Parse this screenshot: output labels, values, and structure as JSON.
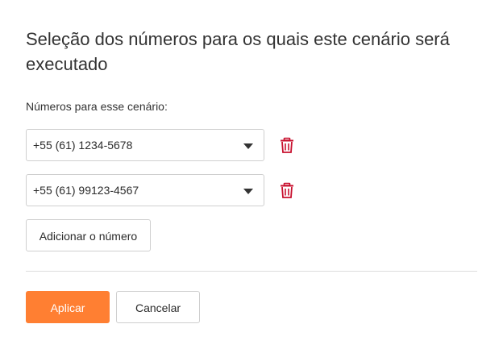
{
  "title": "Seleção dos números para os quais este cenário será executado",
  "numbers_label": "Números para esse cenário:",
  "numbers": [
    {
      "value": "+55 (61) 1234-5678",
      "delete_icon": "trash-icon"
    },
    {
      "value": "+55 (61) 99123-4567",
      "delete_icon": "trash-icon"
    }
  ],
  "add_button_label": "Adicionar o número",
  "apply_button_label": "Aplicar",
  "cancel_button_label": "Cancelar",
  "colors": {
    "accent": "#ff7f32",
    "danger": "#c8102e",
    "border": "#cfcfcf"
  }
}
